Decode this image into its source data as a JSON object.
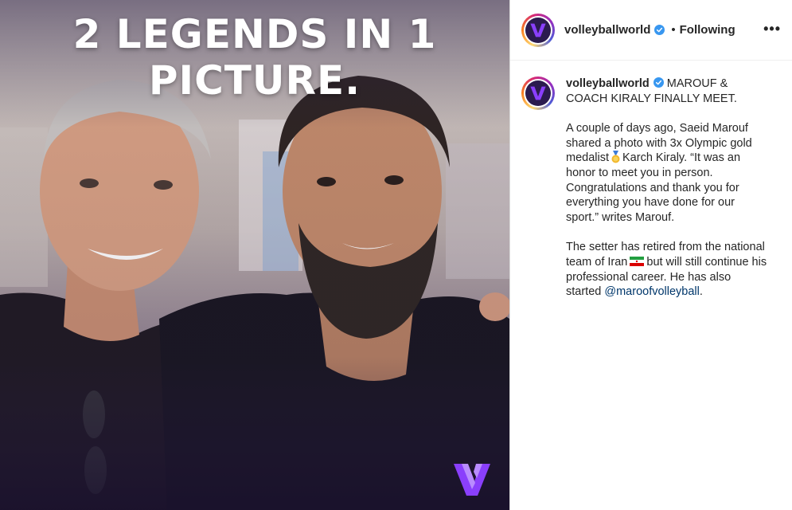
{
  "post": {
    "image": {
      "headline_line1": "2 LEGENDS IN 1",
      "headline_line2": "PICTURE.",
      "brand_color": "#8a3ffc"
    },
    "header": {
      "username": "volleyballworld",
      "separator": "•",
      "follow_status": "Following",
      "more_label": "•••"
    },
    "caption": {
      "username": "volleyballworld",
      "title": "MAROUF & COACH KIRALY FINALLY MEET.",
      "p1_a": "A couple of days ago, Saeid Marouf shared a photo with 3x Olympic gold medalist",
      "p1_b": "Karch Kiraly. “It was an honor to meet you in person. Congratulations and thank you for everything you have done for our sport.” writes Marouf.",
      "p2_a": "The setter has retired from the national team of Iran",
      "p2_b": "but will still continue his professional career. He has also started",
      "mention": "@maroofvolleyball",
      "p2_end": "."
    }
  },
  "colors": {
    "verified_blue": "#3897f0",
    "mention": "#00376b",
    "photo_bg": "#2a1d44"
  },
  "icons": [
    "verified-badge-icon",
    "more-options-icon",
    "gold-medal-emoji",
    "iran-flag-emoji",
    "volleyballworld-logo"
  ]
}
